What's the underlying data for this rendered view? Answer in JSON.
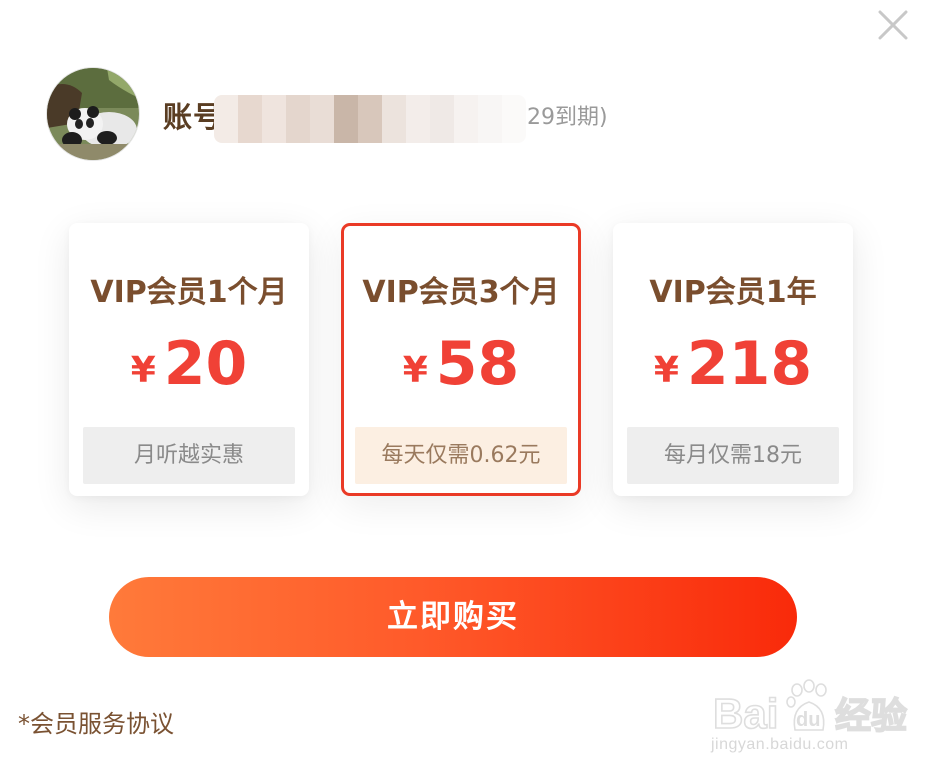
{
  "header": {
    "close_icon": "close-icon"
  },
  "account": {
    "avatar_icon": "panda-avatar",
    "label": "账号",
    "expiry_suffix": "29到期)"
  },
  "plans": [
    {
      "title": "VIP会员1个月",
      "currency": "¥",
      "price": "20",
      "note": "月听越实惠",
      "selected": false
    },
    {
      "title": "VIP会员3个月",
      "currency": "¥",
      "price": "58",
      "note": "每天仅需0.62元",
      "selected": true
    },
    {
      "title": "VIP会员1年",
      "currency": "¥",
      "price": "218",
      "note": "每月仅需18元",
      "selected": false
    }
  ],
  "actions": {
    "buy_label": "立即购买",
    "agreement_label": "*会员服务协议"
  },
  "colors": {
    "accent": "#f04136",
    "selected_border": "#ea3a26",
    "title": "#7a4e2e",
    "button_start": "#ff7a3a",
    "button_end": "#f92a0a"
  },
  "watermark": {
    "logo_text": "Bai du 经验",
    "url_text": "jingyan.baidu.com"
  }
}
